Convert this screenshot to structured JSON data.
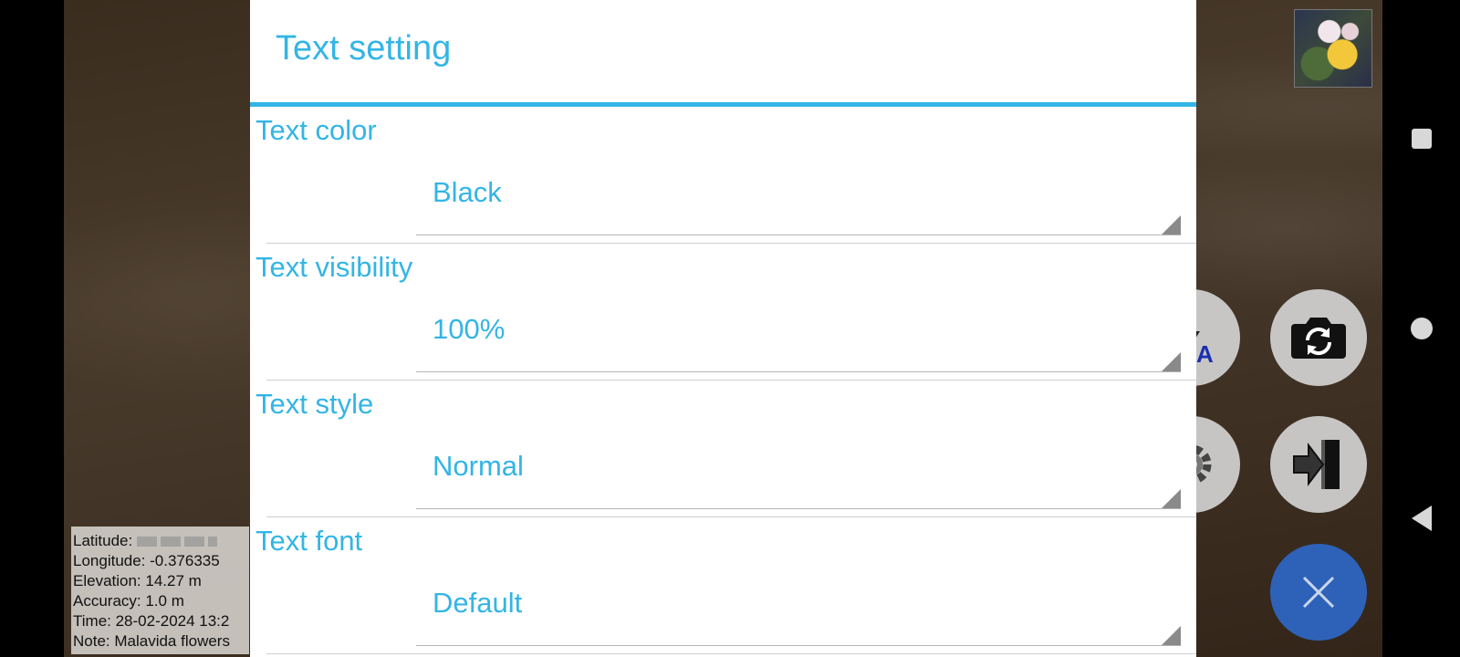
{
  "dialog": {
    "title": "Text setting",
    "settings": [
      {
        "label": "Text color",
        "value": "Black"
      },
      {
        "label": "Text visibility",
        "value": "100%"
      },
      {
        "label": "Text style",
        "value": "Normal"
      },
      {
        "label": "Text font",
        "value": "Default"
      }
    ]
  },
  "gps_overlay": {
    "latitude_label": "Latitude:",
    "longitude": "Longitude: -0.376335",
    "elevation": "Elevation: 14.27 m",
    "accuracy": "Accuracy: 1.0 m",
    "time": "Time: 28-02-2024 13:2",
    "note": "Note: Malavida flowers"
  },
  "camera_controls": {
    "flash_mode_label": "A",
    "icons": [
      "flash-auto-icon",
      "switch-camera-icon",
      "settings-gear-icon",
      "exit-icon",
      "close-icon"
    ]
  },
  "colors": {
    "accent": "#33b5e5",
    "close_button": "#2e62b8"
  }
}
